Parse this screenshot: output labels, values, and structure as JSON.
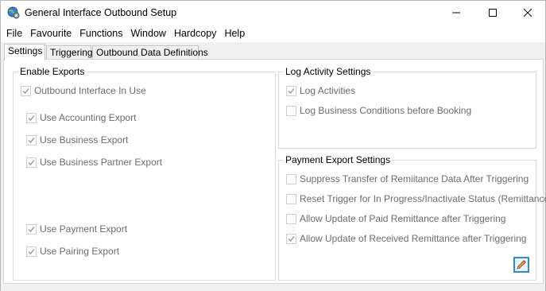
{
  "window": {
    "title": "General Interface Outbound Setup",
    "icon": "globe-gear-icon"
  },
  "menu": [
    "File",
    "Favourite",
    "Functions",
    "Window",
    "Hardcopy",
    "Help"
  ],
  "tabs": [
    {
      "label": "Settings",
      "active": true
    },
    {
      "label": "Triggering",
      "active": false
    },
    {
      "label": "Outbound Data Definitions",
      "active": false
    }
  ],
  "enable_exports": {
    "title": "Enable Exports",
    "items": [
      {
        "label": "Outbound Interface In Use",
        "checked": true
      },
      {
        "label": "Use Accounting Export",
        "checked": true
      },
      {
        "label": "Use Business Export",
        "checked": true
      },
      {
        "label": "Use Business Partner Export",
        "checked": true
      },
      {
        "label": "Use Payment Export",
        "checked": true
      },
      {
        "label": "Use Pairing Export",
        "checked": true
      }
    ]
  },
  "log_activity": {
    "title": "Log Activity Settings",
    "items": [
      {
        "label": "Log Activities",
        "checked": true
      },
      {
        "label": "Log Business Conditions before Booking",
        "checked": false
      }
    ]
  },
  "payment_export": {
    "title": "Payment Export Settings",
    "items": [
      {
        "label": "Suppress Transfer of Remiitance Data After Triggering",
        "checked": false
      },
      {
        "label": "Reset Trigger for In Progress/Inactivate Status (Remittance)",
        "checked": false
      },
      {
        "label": "Allow Update of Paid Remittance after Triggering",
        "checked": false
      },
      {
        "label": "Allow Update of Received Remittance after Triggering",
        "checked": true
      }
    ],
    "edit_icon": "pencil-edit-icon"
  },
  "colors": {
    "disabled_text": "#6d6d6d",
    "accent": "#2f8bd1"
  }
}
